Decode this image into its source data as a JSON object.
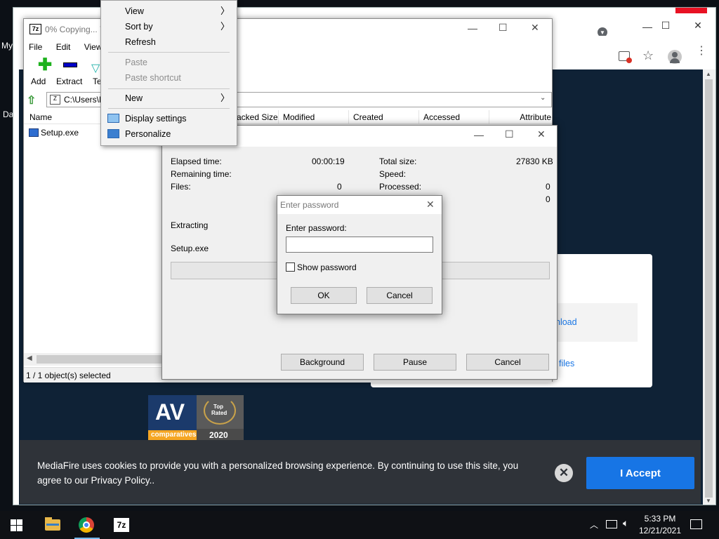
{
  "desktop": {
    "icon1_label": "My",
    "icon2_label": "Da"
  },
  "chrome": {
    "title_buttons": {
      "min": "—",
      "max": "☐",
      "close": "✕"
    }
  },
  "mediafire": {
    "download_link": "nload",
    "files_link": "files",
    "cookie_message": "MediaFire uses cookies to provide you with a personalized browsing experience. By continuing to use this site, you agree to our Privacy Policy..",
    "accept_label": "I Accept",
    "dismiss_label": "✕",
    "av_brand": "AV",
    "av_sub": "comparatives",
    "av_badge_top": "Top",
    "av_badge_bottom": "Rated",
    "av_year": "2020",
    "av_color": "#1b3a6b",
    "av_accent": "#f5a623"
  },
  "zip": {
    "title": "0% Copying... 7",
    "menu": [
      "File",
      "Edit",
      "View"
    ],
    "tools": [
      "Add",
      "Extract",
      "Te"
    ],
    "path": "C:\\Users\\D",
    "columns": [
      "Name",
      "acked Size",
      "Modified",
      "Created",
      "Accessed",
      "Attribute"
    ],
    "file": "Setup.exe",
    "status": "1 / 1 object(s) selected"
  },
  "progress": {
    "elapsed_label": "Elapsed time:",
    "elapsed_value": "00:00:19",
    "remaining_label": "Remaining time:",
    "files_label": "Files:",
    "files_value": "0",
    "total_label": "Total size:",
    "total_value": "27830 KB",
    "speed_label": "Speed:",
    "processed_label": "Processed:",
    "processed_value": "0",
    "extra_value": "0",
    "extracting_label": "Extracting",
    "current_file": "Setup.exe",
    "background_label": "Background",
    "pause_label": "Pause",
    "cancel_label": "Cancel"
  },
  "password": {
    "title": "Enter password",
    "prompt": "Enter password:",
    "value": "",
    "show_label": "Show password",
    "ok_label": "OK",
    "cancel_label": "Cancel"
  },
  "context_menu": {
    "view": "View",
    "sort_by": "Sort by",
    "refresh": "Refresh",
    "paste": "Paste",
    "paste_shortcut": "Paste shortcut",
    "new": "New",
    "display_settings": "Display settings",
    "personalize": "Personalize"
  },
  "taskbar": {
    "time": "5:33 PM",
    "date": "12/21/2021",
    "zip_label": "7z"
  }
}
